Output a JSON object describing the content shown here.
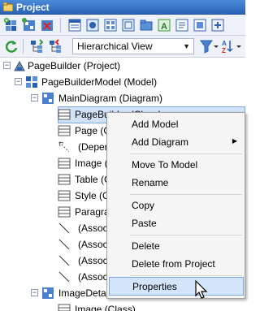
{
  "panel": {
    "title": "Project"
  },
  "toolbar2": {
    "view_select": {
      "value": "Hierarchical View"
    }
  },
  "tree": {
    "rows": [
      {
        "label": "PageBuilder (Project)"
      },
      {
        "label": "PageBuilderModel (Model)"
      },
      {
        "label": "MainDiagram (Diagram)"
      },
      {
        "label": "PageBuilder (Class)"
      },
      {
        "label": "Page (Class)"
      },
      {
        "label": "(Dependency)"
      },
      {
        "label": "Image (Class)"
      },
      {
        "label": "Table (Class)"
      },
      {
        "label": "Style (Class)"
      },
      {
        "label": "Paragraph (Class)"
      },
      {
        "label": "(Association)"
      },
      {
        "label": "(Association)"
      },
      {
        "label": "(Association)"
      },
      {
        "label": "(Association)"
      },
      {
        "label": "ImageDetail (Diagram)"
      },
      {
        "label": "Image (Class)"
      }
    ]
  },
  "context_menu": {
    "items": [
      {
        "label": "Add Model"
      },
      {
        "label": "Add Diagram"
      },
      {
        "label": "Move To Model"
      },
      {
        "label": "Rename"
      },
      {
        "label": "Copy"
      },
      {
        "label": "Paste"
      },
      {
        "label": "Delete"
      },
      {
        "label": "Delete from Project"
      },
      {
        "label": "Properties"
      }
    ]
  }
}
